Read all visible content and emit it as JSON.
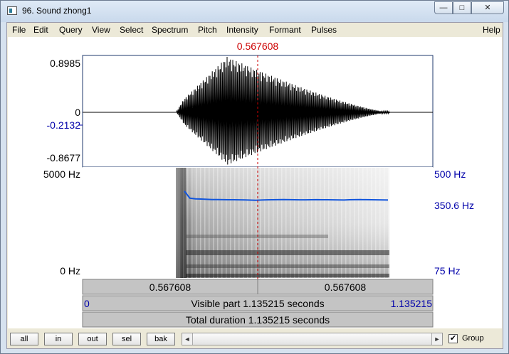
{
  "window": {
    "title": "96. Sound zhong1",
    "min_glyph": "—",
    "max_glyph": "□",
    "close_glyph": "✕"
  },
  "menu": [
    "File",
    "Edit",
    "Query",
    "View",
    "Select",
    "Spectrum",
    "Pitch",
    "Intensity",
    "Formant",
    "Pulses"
  ],
  "help": "Help",
  "cursor": {
    "time_label": "0.567608",
    "time": 0.567608
  },
  "waveform": {
    "y_top": "0.8985",
    "y_zero": "0",
    "y_cursor": "-0.2132",
    "y_bottom": "-0.8677"
  },
  "spectrogram": {
    "freq_top": "5000 Hz",
    "freq_bottom": "0 Hz"
  },
  "pitch": {
    "top": "500 Hz",
    "current": "350.6 Hz",
    "bottom": "75 Hz",
    "track_hz": [
      470,
      370,
      362,
      360,
      356,
      354,
      353,
      352,
      351,
      351,
      350,
      349,
      347,
      345,
      348,
      350,
      351,
      352,
      353,
      352,
      351,
      350,
      350,
      351,
      352,
      351,
      351,
      350,
      349,
      348,
      351,
      352,
      353,
      352,
      351,
      350,
      349,
      348
    ]
  },
  "time_axis": {
    "left_cell": "0.567608",
    "right_cell": "0.567608",
    "visible_start": "0",
    "visible_label": "Visible part 1.135215 seconds",
    "visible_end": "1.135215",
    "total_label": "Total duration 1.135215 seconds"
  },
  "buttons": {
    "all": "all",
    "in": "in",
    "out": "out",
    "sel": "sel",
    "bak": "bak"
  },
  "scroll": {
    "left": "◄",
    "right": "►"
  },
  "group": {
    "label": "Group",
    "checked": true,
    "mark": "✔"
  },
  "colors": {
    "cursor": "#cc0000",
    "pitch": "#1155dd",
    "blue_text": "#0000aa"
  }
}
